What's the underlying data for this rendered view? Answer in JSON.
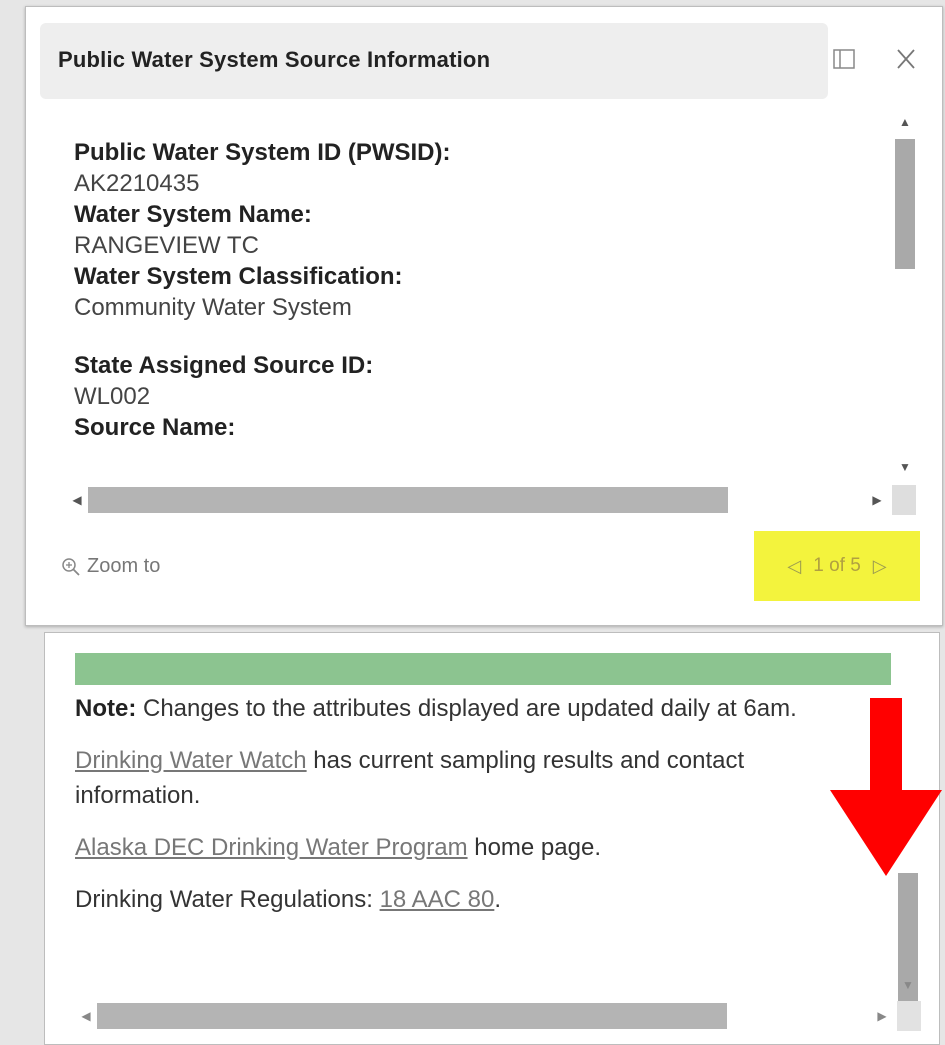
{
  "popup": {
    "title": "Public Water System Source Information",
    "fields": [
      {
        "label": "Public Water System ID (PWSID):",
        "value": "AK2210435"
      },
      {
        "label": "Water System Name:",
        "value": "RANGEVIEW TC"
      },
      {
        "label": "Water System Classification:",
        "value": "Community Water System"
      },
      {
        "label": "State Assigned Source ID:",
        "value": "WL002"
      },
      {
        "label": "Source Name:",
        "value": ""
      }
    ],
    "zoom_label": "Zoom to",
    "pager": {
      "text": "1 of 5",
      "prev_icon": "triangle-left-icon",
      "next_icon": "triangle-right-icon",
      "highlight_color": "#f3f33d"
    }
  },
  "panel2": {
    "note_label": "Note:",
    "note_text": " Changes to the attributes displayed are updated daily at 6am.",
    "line2_link": "Drinking Water Watch",
    "line2_text": " has current sampling results and contact information.",
    "line3_link": "Alaska DEC Drinking Water Program",
    "line3_text": " home page.",
    "line4_text": "Drinking Water Regulations: ",
    "line4_link": "18 AAC 80",
    "line4_end": ".",
    "bar_color": "#8cc490"
  },
  "annotation": {
    "arrow_color": "#ff0000",
    "arrow_icon": "down-arrow-icon"
  }
}
